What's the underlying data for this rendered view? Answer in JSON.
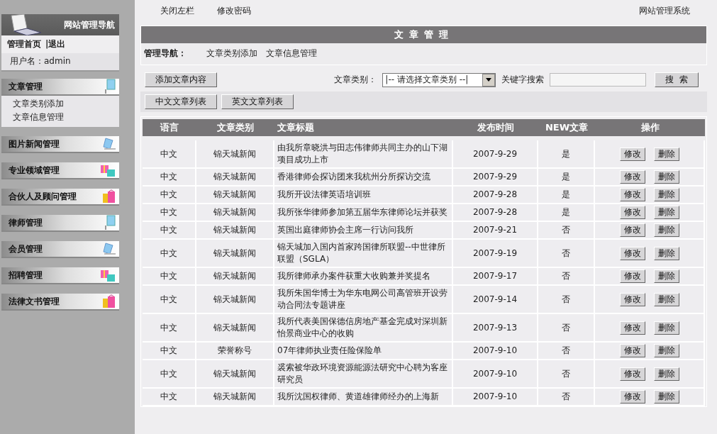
{
  "sidebar": {
    "title": "网站管理导航",
    "links": [
      "管理首页",
      "|退出"
    ],
    "user": "用户名：admin",
    "sections": [
      {
        "title": "文章管理",
        "children": [
          "文章类别添加",
          "文章信息管理"
        ]
      },
      {
        "title": "图片新闻管理"
      },
      {
        "title": "专业领域管理"
      },
      {
        "title": "合伙人及顾问管理"
      },
      {
        "title": "律师管理"
      },
      {
        "title": "会员管理"
      },
      {
        "title": "招聘管理"
      },
      {
        "title": "法律文书管理"
      }
    ]
  },
  "topbar": {
    "links": [
      "关闭左栏",
      "修改密码"
    ],
    "system": "网站管理系统"
  },
  "panel": {
    "title": "文章管理",
    "nav_label": "管理导航：",
    "nav_links": [
      "文章类别添加",
      "文章信息管理"
    ]
  },
  "toolbar": {
    "add_button": "添加文章内容",
    "category_label": "文章类别：",
    "category_select": "|-- 请选择文章类别 --|",
    "keyword_label": "关键字搜索",
    "search_button": "搜  索",
    "list_buttons": [
      "中文文章列表",
      "英文文章列表"
    ]
  },
  "table": {
    "columns": [
      "语言",
      "文章类别",
      "文章标题",
      "发布时间",
      "NEW文章",
      "操作"
    ],
    "rows": [
      {
        "lang": "中文",
        "category": "锦天城新闻",
        "title": "由我所章晓洪与田志伟律师共同主办的山下湖项目成功上市",
        "date": "2007-9-29",
        "new": "是",
        "actions": [
          "修改",
          "删除"
        ]
      },
      {
        "lang": "中文",
        "category": "锦天城新闻",
        "title": "香港律师会探访团来我杭州分所探访交流",
        "date": "2007-9-29",
        "new": "是",
        "actions": [
          "修改",
          "删除"
        ]
      },
      {
        "lang": "中文",
        "category": "锦天城新闻",
        "title": "我所开设法律英语培训班",
        "date": "2007-9-28",
        "new": "是",
        "actions": [
          "修改",
          "删除"
        ]
      },
      {
        "lang": "中文",
        "category": "锦天城新闻",
        "title": "我所张华律师参加第五届华东律师论坛并获奖",
        "date": "2007-9-28",
        "new": "是",
        "actions": [
          "修改",
          "删除"
        ]
      },
      {
        "lang": "中文",
        "category": "锦天城新闻",
        "title": "英国出庭律师协会主席一行访问我所",
        "date": "2007-9-21",
        "new": "否",
        "actions": [
          "修改",
          "删除"
        ]
      },
      {
        "lang": "中文",
        "category": "锦天城新闻",
        "title": "锦天城加入国内首家跨国律所联盟--中世律所联盟（SGLA）",
        "date": "2007-9-19",
        "new": "否",
        "actions": [
          "修改",
          "删除"
        ]
      },
      {
        "lang": "中文",
        "category": "锦天城新闻",
        "title": "我所律师承办案件获重大收购兼并奖提名",
        "date": "2007-9-17",
        "new": "否",
        "actions": [
          "修改",
          "删除"
        ]
      },
      {
        "lang": "中文",
        "category": "锦天城新闻",
        "title": "我所朱国华博士为华东电网公司高管班开设劳动合同法专题讲座",
        "date": "2007-9-14",
        "new": "否",
        "actions": [
          "修改",
          "删除"
        ]
      },
      {
        "lang": "中文",
        "category": "锦天城新闻",
        "title": "我所代表美国保德信房地产基金完成对深圳新怡景商业中心的收购",
        "date": "2007-9-13",
        "new": "否",
        "actions": [
          "修改",
          "删除"
        ]
      },
      {
        "lang": "中文",
        "category": "荣誉称号",
        "title": "07年律师执业责任险保险单",
        "date": "2007-9-10",
        "new": "否",
        "actions": [
          "修改",
          "删除"
        ]
      },
      {
        "lang": "中文",
        "category": "锦天城新闻",
        "title": "裘索被华政环境资源能源法研究中心聘为客座研究员",
        "date": "2007-9-10",
        "new": "否",
        "actions": [
          "修改",
          "删除"
        ]
      },
      {
        "lang": "中文",
        "category": "锦天城新闻",
        "title": "我所沈国权律师、黄道雄律师经办的上海新",
        "date": "2007-9-10",
        "new": "否",
        "actions": [
          "修改",
          "删除"
        ]
      }
    ]
  }
}
